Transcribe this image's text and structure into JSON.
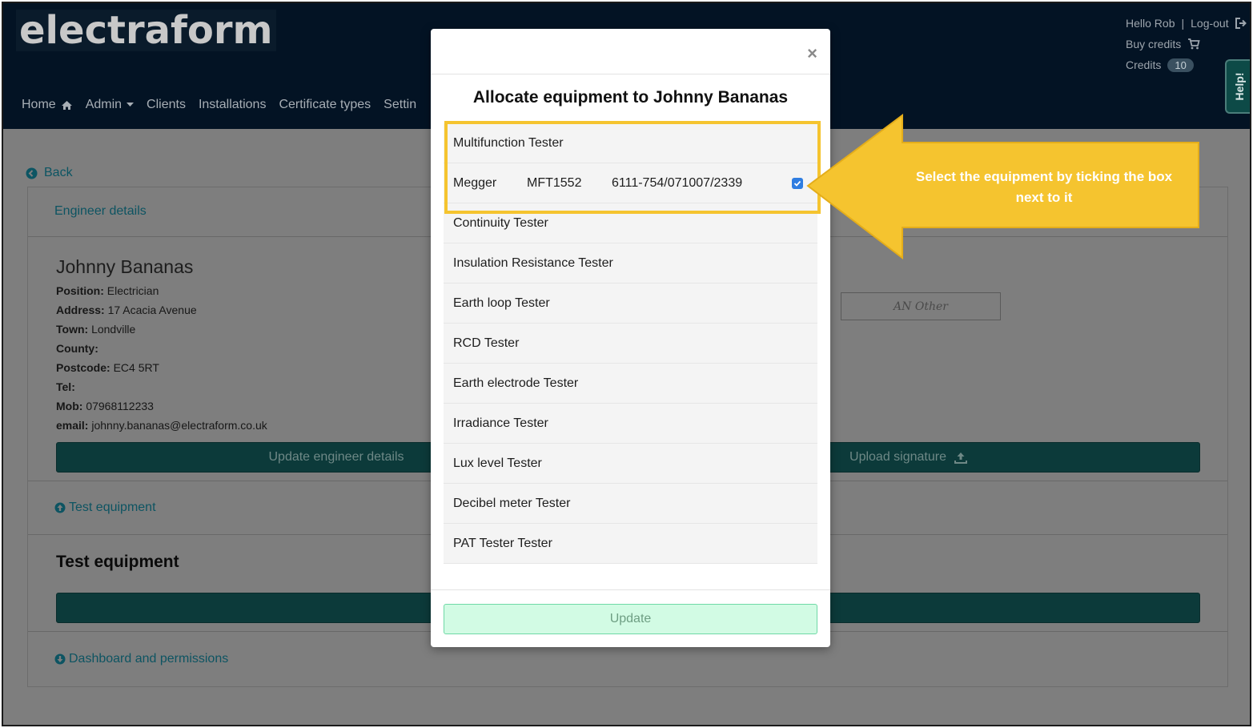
{
  "header": {
    "logo": "electraform",
    "greeting": "Hello Rob",
    "separator": "|",
    "logout": "Log-out",
    "buy_credits": "Buy credits",
    "credits_label": "Credits",
    "credits_count": "10",
    "help": "Help!"
  },
  "nav": {
    "home": "Home",
    "admin": "Admin",
    "clients": "Clients",
    "installations": "Installations",
    "certificate_types": "Certificate types",
    "settings": "Settin"
  },
  "page": {
    "back": "Back",
    "engineer_details": "Engineer details",
    "engineer_name": "Johnny Bananas",
    "fields": [
      {
        "label": "Position:",
        "value": "Electrician"
      },
      {
        "label": "Address:",
        "value": "17 Acacia Avenue"
      },
      {
        "label": "Town:",
        "value": "Londville"
      },
      {
        "label": "County:",
        "value": ""
      },
      {
        "label": "Postcode:",
        "value": "EC4 5RT"
      },
      {
        "label": "Tel:",
        "value": ""
      },
      {
        "label": "Mob:",
        "value": "07968112233"
      },
      {
        "label": "email:",
        "value": "johnny.bananas@electraform.co.uk"
      }
    ],
    "signature_text": "AN Other",
    "update_engineer_button": "Update engineer details",
    "upload_signature_button": "Upload signature",
    "test_equipment_link": "Test equipment",
    "test_equipment_heading": "Test equipment",
    "dashboard_link": "Dashboard and permissions"
  },
  "modal": {
    "close": "×",
    "title": "Allocate equipment to Johnny Bananas",
    "items": [
      {
        "label": "Multifunction Tester"
      },
      {
        "make": "Megger",
        "model": "MFT1552",
        "serial": "6111-754/071007/2339",
        "checked": true
      },
      {
        "label": "Continuity Tester"
      },
      {
        "label": "Insulation Resistance Tester"
      },
      {
        "label": "Earth loop Tester"
      },
      {
        "label": "RCD Tester"
      },
      {
        "label": "Earth electrode Tester"
      },
      {
        "label": "Irradiance Tester"
      },
      {
        "label": "Lux level Tester"
      },
      {
        "label": "Decibel meter Tester"
      },
      {
        "label": "PAT Tester Tester"
      }
    ],
    "update_button": "Update"
  },
  "callout": {
    "text": "Select the equipment by ticking the box next to it",
    "color": "#f5c42f"
  }
}
